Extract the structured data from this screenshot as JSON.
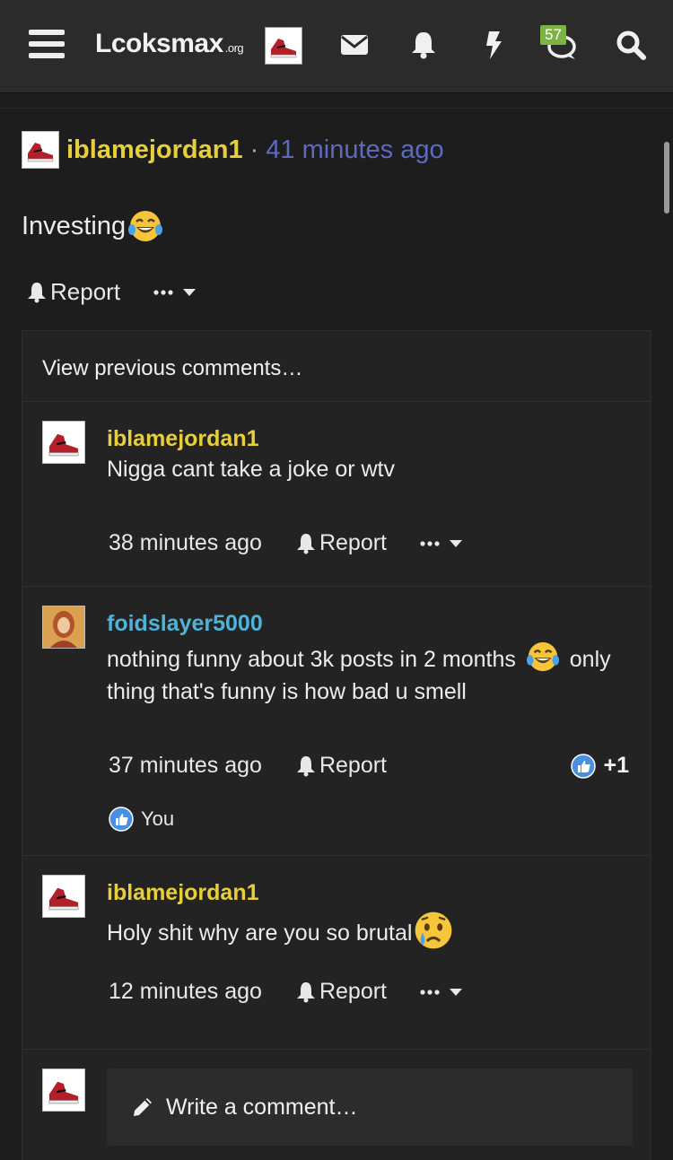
{
  "header": {
    "logo_main": "Lcoksmax",
    "logo_suffix": ".org",
    "badge_count": "57",
    "icons": [
      "menu-icon",
      "mail-icon",
      "bell-icon",
      "bolt-icon",
      "chat-icon",
      "search-icon"
    ]
  },
  "post": {
    "username": "iblamejordan1",
    "separator": "·",
    "time": "41 minutes ago",
    "body": "Investing",
    "report_label": "Report"
  },
  "comments_box": {
    "view_previous": "View previous comments…",
    "comments": [
      {
        "username": "iblamejordan1",
        "text": "Nigga cant take a joke or wtv",
        "time": "38 minutes ago",
        "report_label": "Report"
      },
      {
        "username": "foidslayer5000",
        "text_1": "nothing funny about 3k posts in 2 months",
        "text_2": "only",
        "text_3": "thing that's funny is how bad u smell",
        "time": "37 minutes ago",
        "report_label": "Report",
        "like_count": "+1",
        "reacted_by": "You"
      },
      {
        "username": "iblamejordan1",
        "text": "Holy shit why are you so brutal",
        "time": "12 minutes ago",
        "report_label": "Report"
      }
    ],
    "write_placeholder": "Write a comment…"
  },
  "colors": {
    "username_yellow": "#e7cf3a",
    "username_blue": "#4fb3d9",
    "timestamp_blue": "#5c6bc0",
    "badge_green": "#7cb342"
  }
}
